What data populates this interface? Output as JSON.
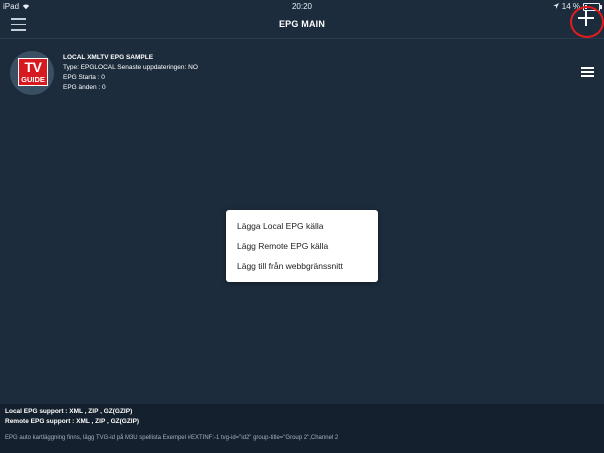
{
  "status_bar": {
    "device": "iPad",
    "time": "20:20",
    "battery_text": "14 %",
    "battery_level": 0.14
  },
  "nav": {
    "title": "EPG MAIN",
    "menu_icon": "hamburger-icon",
    "add_icon": "plus-icon",
    "highlight_color": "#e21c1c"
  },
  "epg_source": {
    "logo_top": "TV",
    "logo_bottom": "GUIDE",
    "title": "LOCAL XMLTV EPG SAMPLE",
    "type_line": "Type: EPGLOCAL Senaste uppdateringen: NO",
    "start_line": "EPG Starta : 0",
    "end_line": "EPG änden : 0",
    "menu_icon": "hamburger-icon"
  },
  "popup": {
    "items": [
      "Lägga Local EPG källa",
      "Lägg Remote EPG källa",
      "Lägg till från webbgränssnitt"
    ]
  },
  "footer": {
    "local_support": "Local EPG support : XML , ZIP , GZ(GZIP)",
    "remote_support": "Remote EPG support : XML , ZIP , GZ(GZIP)",
    "note": "EPG auto kartläggning finns, lägg TVG-id på M3U spellista Exempel #EXTINF:-1 tvg-id=\"id2\" group-title=\"Group 2\",Channel 2"
  },
  "colors": {
    "background": "#1c2c3d",
    "footer_background": "#14202d",
    "logo_red": "#d71920"
  }
}
